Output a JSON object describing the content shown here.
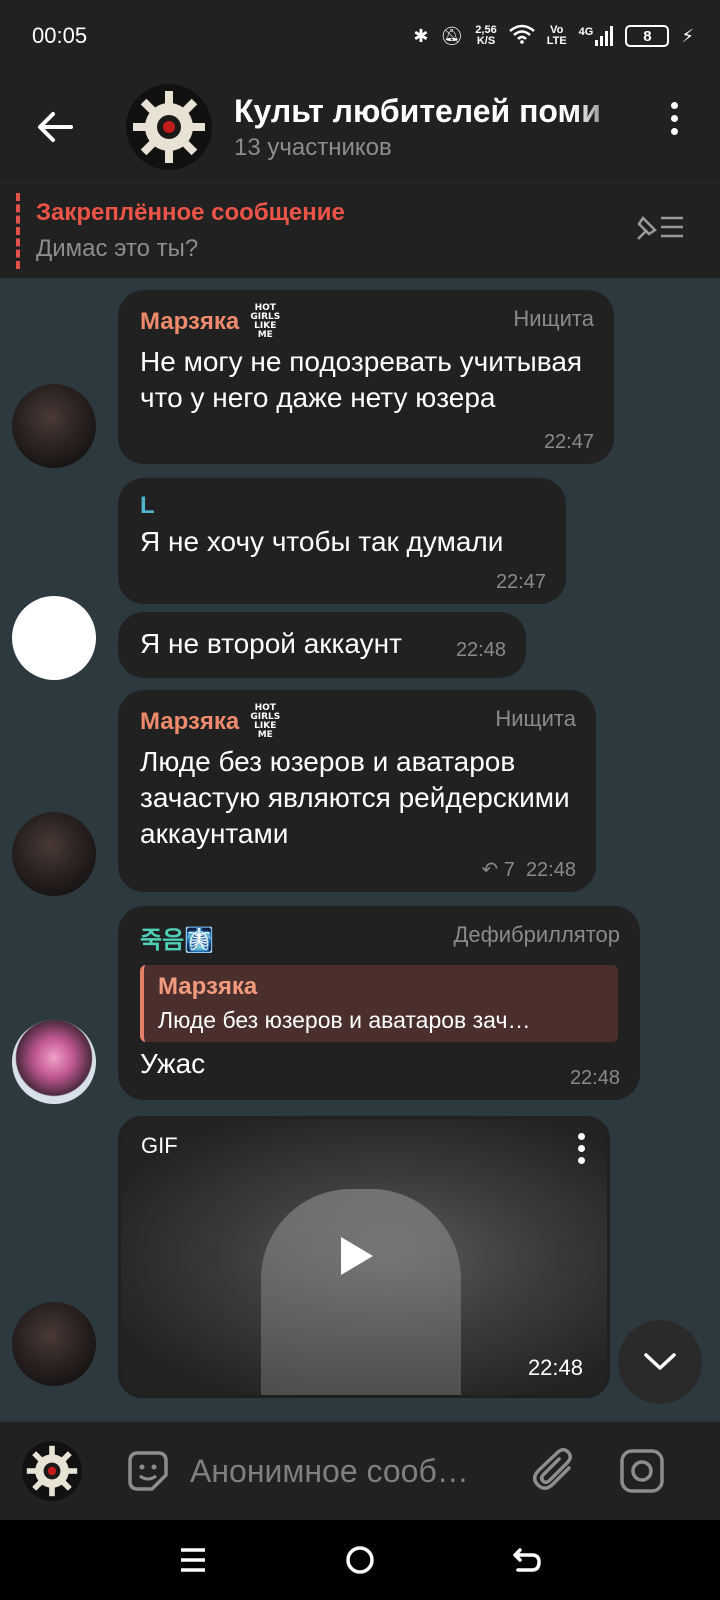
{
  "status_bar": {
    "time": "00:05",
    "net_speed_value": "2,56",
    "net_speed_unit": "K/S",
    "volte_top": "Vo",
    "volte_bottom": "LTE",
    "network": "4G",
    "battery": "8"
  },
  "header": {
    "title": "Культ любителей поми",
    "subtitle": "13 участников"
  },
  "pinned": {
    "title": "Закреплённое сообщение",
    "text": "Димас это ты?"
  },
  "messages": [
    {
      "sender": "Марзяка",
      "sender_color": "#f08a6c",
      "sticker_tag": "HOT GIRLS LIKE ME",
      "rank": "Нищита",
      "text": "Не могу не подозревать учитывая что у него даже нету юзера",
      "time": "22:47"
    },
    {
      "sender": "L",
      "sender_color": "#4fb6d0",
      "text": "Я не хочу чтобы так думали",
      "time": "22:47"
    },
    {
      "text": "Я не второй аккаунт",
      "time": "22:48"
    },
    {
      "sender": "Марзяка",
      "sender_color": "#f08a6c",
      "sticker_tag": "HOT GIRLS LIKE ME",
      "rank": "Нищита",
      "text": "Люде без юзеров и аватаров зачастую являются рейдерскими аккаунтами",
      "replies": "7",
      "time": "22:48"
    },
    {
      "sender": "죽음🩻",
      "sender_color": "#4fd0b8",
      "rank": "Дефибриллятор",
      "reply_name": "Марзяка",
      "reply_text": "Люде без юзеров и аватаров зач…",
      "text": "Ужас",
      "time": "22:48"
    },
    {
      "media_label": "GIF",
      "time": "22:48"
    }
  ],
  "input": {
    "placeholder": "Анонимное сооб…"
  },
  "colors": {
    "chat_background": "#2c3a40",
    "bubble": "#212121",
    "pinned_accent": "#ed5448"
  },
  "icons": [
    "back-arrow-icon",
    "more-vert-icon",
    "unpin-list-icon",
    "sticker-icon",
    "paperclip-icon",
    "camera-icon",
    "chevron-down-icon"
  ]
}
